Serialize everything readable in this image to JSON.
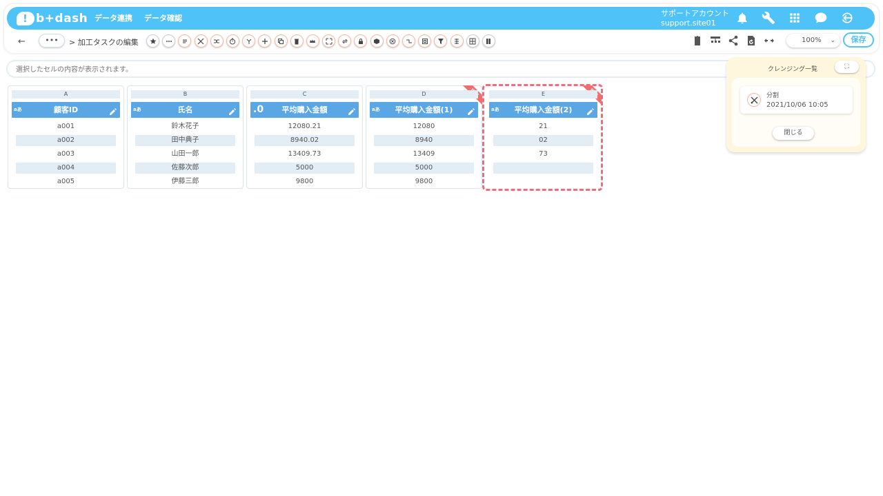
{
  "header": {
    "logo_text": "b+dash",
    "nav": [
      {
        "label": "データ連携"
      },
      {
        "label": "データ確認"
      }
    ],
    "account_name": "サポートアカウント",
    "account_site": "support.site01"
  },
  "toolbar": {
    "dots_label": "•••",
    "breadcrumb": "> 加工タスクの編集",
    "zoom_value": "100%",
    "save_label": "保存"
  },
  "cellbar": {
    "placeholder": "選択したセルの内容が表示されます。"
  },
  "columns": [
    {
      "letter": "A",
      "type": "aあ",
      "name": "顧客ID",
      "cells": [
        "a001",
        "a002",
        "a003",
        "a004",
        "a005"
      ],
      "is_new": false
    },
    {
      "letter": "B",
      "type": "aあ",
      "name": "氏名",
      "cells": [
        "鈴木花子",
        "田中典子",
        "山田一郎",
        "佐藤次郎",
        "伊藤三郎"
      ],
      "is_new": false
    },
    {
      "letter": "C",
      "type": ".0",
      "name": "平均購入金額",
      "cells": [
        "12080.21",
        "8940.02",
        "13409.73",
        "5000",
        "9800"
      ],
      "is_new": false
    },
    {
      "letter": "D",
      "type": "aあ",
      "name": "平均購入金額(1)",
      "cells": [
        "12080",
        "8940",
        "13409",
        "5000",
        "9800"
      ],
      "is_new": true
    },
    {
      "letter": "E",
      "type": "aあ",
      "name": "平均購入金額(2)",
      "cells": [
        "21",
        "02",
        "73",
        "",
        ""
      ],
      "is_new": true
    }
  ],
  "new_badge": "NEW",
  "panel": {
    "title": "クレンジング一覧",
    "expand_label": "⛶",
    "history": [
      {
        "name": "分割",
        "time": "2021/10/06 10:05"
      }
    ],
    "close_label": "閉じる"
  },
  "colors": {
    "brand": "#4fc3f7",
    "column_header": "#5ba7e6",
    "selection": "#ee6d7d",
    "new_badge": "#f26d6d"
  }
}
